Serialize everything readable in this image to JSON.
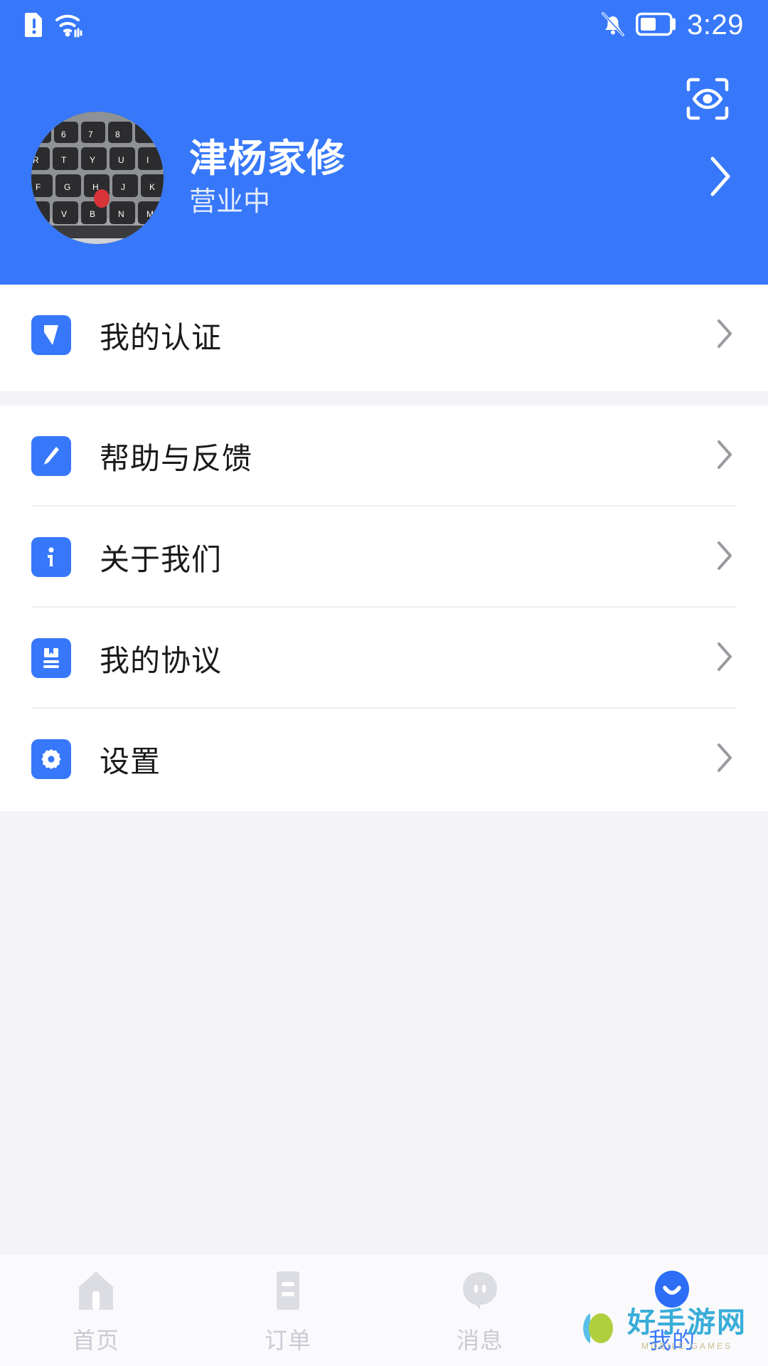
{
  "statusbar": {
    "time": "3:29",
    "icons": {
      "sim_alert": "sim-alert-icon",
      "wifi": "wifi-icon",
      "bell_muted": "bell-muted-icon",
      "battery": "battery-icon"
    },
    "battery_level_percent": 50
  },
  "header": {
    "scan_icon": "eye-scan-icon",
    "avatar_alt": "keyboard-avatar",
    "shop_name": "津杨家修",
    "shop_status": "营业中",
    "arrow": "chevron-right-icon",
    "background_color": "#3778FA"
  },
  "menu": {
    "group_certification": [
      {
        "icon": "verified-badge-icon",
        "label": "我的认证",
        "arrow": "chevron-right-icon"
      }
    ],
    "group_general": [
      {
        "icon": "pencil-edit-icon",
        "label": "帮助与反馈",
        "arrow": "chevron-right-icon"
      },
      {
        "icon": "info-circle-icon",
        "label": "关于我们",
        "arrow": "chevron-right-icon"
      },
      {
        "icon": "document-bookmark-icon",
        "label": "我的协议",
        "arrow": "chevron-right-icon"
      },
      {
        "icon": "gear-icon",
        "label": "设置",
        "arrow": "chevron-right-icon"
      }
    ]
  },
  "tabbar": {
    "items": [
      {
        "icon": "home-icon",
        "label": "首页",
        "active": false
      },
      {
        "icon": "order-list-icon",
        "label": "订单",
        "active": false
      },
      {
        "icon": "message-bubble-icon",
        "label": "消息",
        "active": false
      },
      {
        "icon": "profile-smile-icon",
        "label": "我的",
        "active": true
      }
    ],
    "active_color": "#3778FA",
    "inactive_color": "#C9CBD4"
  },
  "watermark": {
    "logo": "hsyw-logo-icon",
    "title": "好手游网",
    "subtitle": "MOBILE GAMES"
  }
}
